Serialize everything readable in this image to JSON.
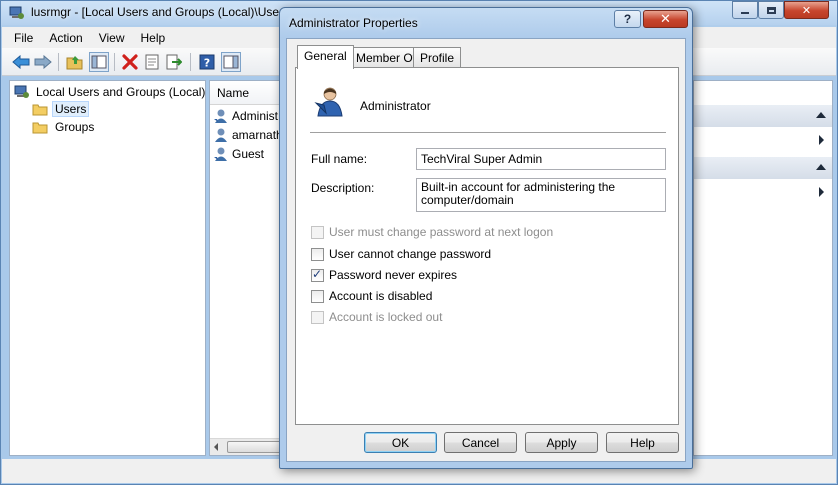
{
  "main_window": {
    "title": "lusrmgr - [Local Users and Groups (Local)\\Users]",
    "menu": [
      "File",
      "Action",
      "View",
      "Help"
    ],
    "toolbar_icons": [
      "back-arrow-icon",
      "forward-arrow-icon",
      "up-folder-icon",
      "show-hide-tree-icon",
      "delete-icon",
      "properties-icon",
      "export-icon",
      "help-icon",
      "show-hide-action-pane-icon"
    ],
    "tree": {
      "root": "Local Users and Groups (Local)",
      "items": [
        "Users",
        "Groups"
      ],
      "selected": "Users"
    },
    "list": {
      "column_name": "Name",
      "rows": [
        "Administ",
        "amarnath",
        "Guest"
      ]
    }
  },
  "dialog": {
    "title": "Administrator Properties",
    "tabs": [
      {
        "label": "General",
        "active": true
      },
      {
        "label": "Member Of",
        "active": false
      },
      {
        "label": "Profile",
        "active": false
      }
    ],
    "user_name": "Administrator",
    "fields": {
      "full_name_label": "Full name:",
      "full_name_value": "TechViral Super Admin",
      "description_label": "Description:",
      "description_value": "Built-in account for administering the computer/domain"
    },
    "checkboxes": [
      {
        "label": "User must change password at next logon",
        "checked": false,
        "enabled": false
      },
      {
        "label": "User cannot change password",
        "checked": false,
        "enabled": true
      },
      {
        "label": "Password never expires",
        "checked": true,
        "enabled": true
      },
      {
        "label": "Account is disabled",
        "checked": false,
        "enabled": true
      },
      {
        "label": "Account is locked out",
        "checked": false,
        "enabled": false
      }
    ],
    "buttons": {
      "ok": "OK",
      "cancel": "Cancel",
      "apply": "Apply",
      "help": "Help"
    },
    "title_buttons": {
      "help": "?",
      "close": "✕"
    }
  },
  "colors": {
    "accent_blue": "#3c7fb1",
    "close_red": "#c7452d",
    "checkmark": "#1f3d7a"
  }
}
